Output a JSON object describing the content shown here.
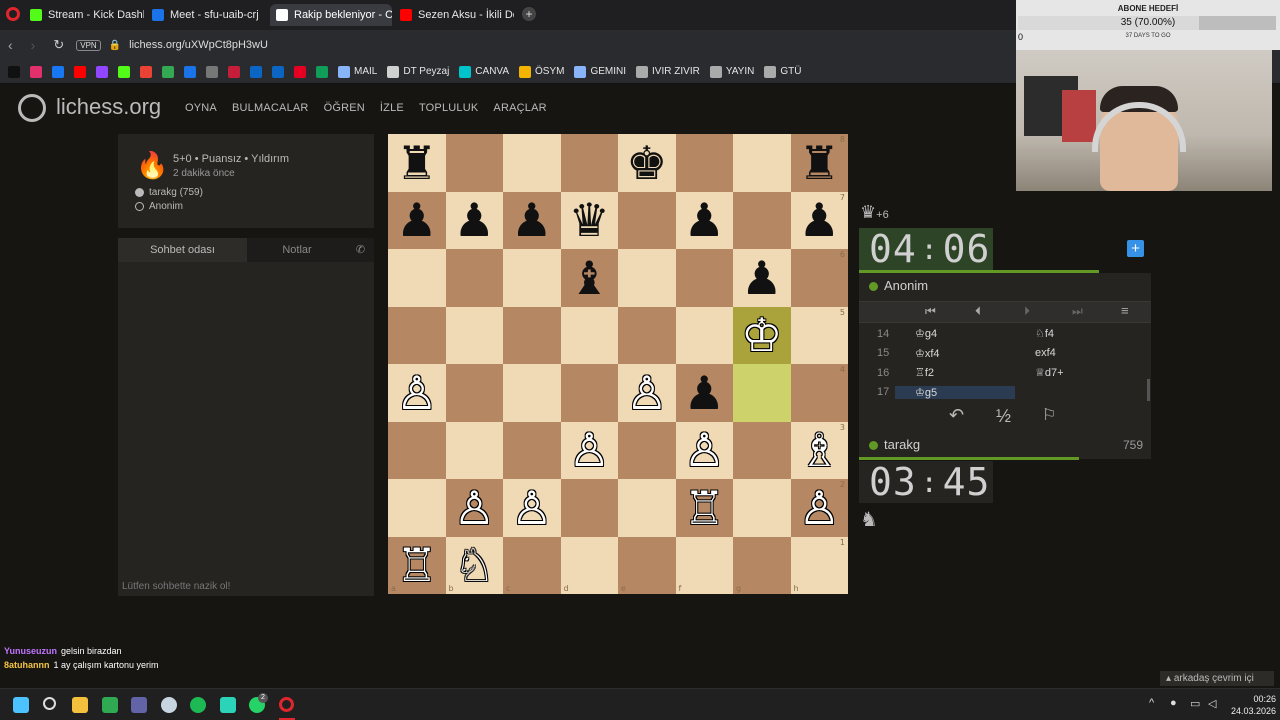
{
  "tabs": [
    {
      "label": "Stream - Kick Dashboard",
      "color": "#53fc18"
    },
    {
      "label": "Meet - sfu-uaib-crj",
      "color": "#1a73e8"
    },
    {
      "label": "Rakip bekleniyor - Oy",
      "color": "#ffffff"
    },
    {
      "label": "Sezen Aksu - İkili Delil",
      "color": "#ff0000"
    }
  ],
  "address": {
    "vpn": "VPN",
    "url": "lichess.org/uXWpCt8pH3wU"
  },
  "bookmarks": [
    {
      "label": "",
      "color": "#111111"
    },
    {
      "label": "",
      "color": "#e1306c"
    },
    {
      "label": "",
      "color": "#1877f2"
    },
    {
      "label": "",
      "color": "#ff0000"
    },
    {
      "label": "",
      "color": "#9146ff"
    },
    {
      "label": "",
      "color": "#53fc18"
    },
    {
      "label": "",
      "color": "#ea4335"
    },
    {
      "label": "",
      "color": "#34a853"
    },
    {
      "label": "",
      "color": "#1a73e8"
    },
    {
      "label": "",
      "color": "#777777"
    },
    {
      "label": "",
      "color": "#c41e3a"
    },
    {
      "label": "",
      "color": "#0a66c2"
    },
    {
      "label": "",
      "color": "#0a66c2"
    },
    {
      "label": "",
      "color": "#e60023"
    },
    {
      "label": "",
      "color": "#0f9d58"
    },
    {
      "label": "MAIL",
      "color": "#8ab4f8"
    },
    {
      "label": "DT Peyzaj",
      "color": "#d0d0d0"
    },
    {
      "label": "CANVA",
      "color": "#00c4cc"
    },
    {
      "label": "ÖSYM",
      "color": "#f4b400"
    },
    {
      "label": "GEMINI",
      "color": "#8ab4f8"
    },
    {
      "label": "IVIR ZIVIR",
      "color": "#aaaaaa"
    },
    {
      "label": "YAYIN",
      "color": "#aaaaaa"
    },
    {
      "label": "GTÜ",
      "color": "#aaaaaa"
    }
  ],
  "site": {
    "logo": "lichess.org",
    "nav": [
      "OYNA",
      "BULMACALAR",
      "ÖĞREN",
      "İZLE",
      "TOPLULUK",
      "ARAÇLAR"
    ]
  },
  "game_info": {
    "title": "5+0 • Puansız • Yıldırım",
    "time_ago": "2 dakika önce",
    "white_player": "tarakg (759)",
    "black_player": "Anonim"
  },
  "chat": {
    "tab_chat": "Sohbet odası",
    "tab_notes": "Notlar",
    "placeholder": "Lütfen sohbette nazik ol!"
  },
  "board": {
    "ranks": [
      "8",
      "7",
      "6",
      "5",
      "4",
      "3",
      "2",
      "1"
    ],
    "files": [
      "a",
      "b",
      "c",
      "d",
      "e",
      "f",
      "g",
      "h"
    ],
    "squares": [
      [
        "♜",
        "",
        "",
        "",
        "♚",
        "",
        "",
        "♜"
      ],
      [
        "♟",
        "♟",
        "♟",
        "♛",
        "",
        "♟",
        "",
        "♟"
      ],
      [
        "",
        "",
        "",
        "♝",
        "",
        "",
        "♟",
        ""
      ],
      [
        "",
        "",
        "",
        "",
        "",
        "",
        "♔",
        ""
      ],
      [
        "♙",
        "",
        "",
        "",
        "♙",
        "♟",
        "",
        ""
      ],
      [
        "",
        "",
        "",
        "♙",
        "",
        "♙",
        "",
        "♗"
      ],
      [
        "",
        "♙",
        "♙",
        "",
        "",
        "♖",
        "",
        "♙"
      ],
      [
        "♖",
        "♘",
        "",
        "",
        "",
        "",
        "",
        ""
      ]
    ],
    "highlight": [
      "g5",
      "g4"
    ]
  },
  "opponent": {
    "material": "+6",
    "clock_min": "04",
    "clock_sec": "06",
    "name": "Anonim"
  },
  "player": {
    "name": "tarakg",
    "rating": "759",
    "clock_min": "03",
    "clock_sec": "45"
  },
  "moves": [
    {
      "num": "14",
      "white": "♔g4",
      "black": "♘f4"
    },
    {
      "num": "15",
      "white": "♔xf4",
      "black": "exf4"
    },
    {
      "num": "16",
      "white": "♖f2",
      "black": "♕d7+"
    },
    {
      "num": "17",
      "white": "♔g5",
      "black": ""
    }
  ],
  "controls": {
    "draw": "½"
  },
  "overlay": {
    "goal_title": "ABONE HEDEFİ",
    "goal_value": "35 (70.00%)",
    "goal_progress": 0.7,
    "goal_left": "0",
    "days": "37 DAYS TO GO",
    "friend_status": "arkadaş çevrim içi"
  },
  "stream_chat": [
    {
      "user": "Yunuseuzun",
      "text": "gelsin birazdan",
      "color": "#c074ff"
    },
    {
      "user": "8atuhannn",
      "text": "1 ay çalışım kartonu yerim",
      "color": "#f5c542"
    }
  ],
  "clock": {
    "time": "00:26",
    "date": "24.03.2026",
    "badge": "2"
  }
}
